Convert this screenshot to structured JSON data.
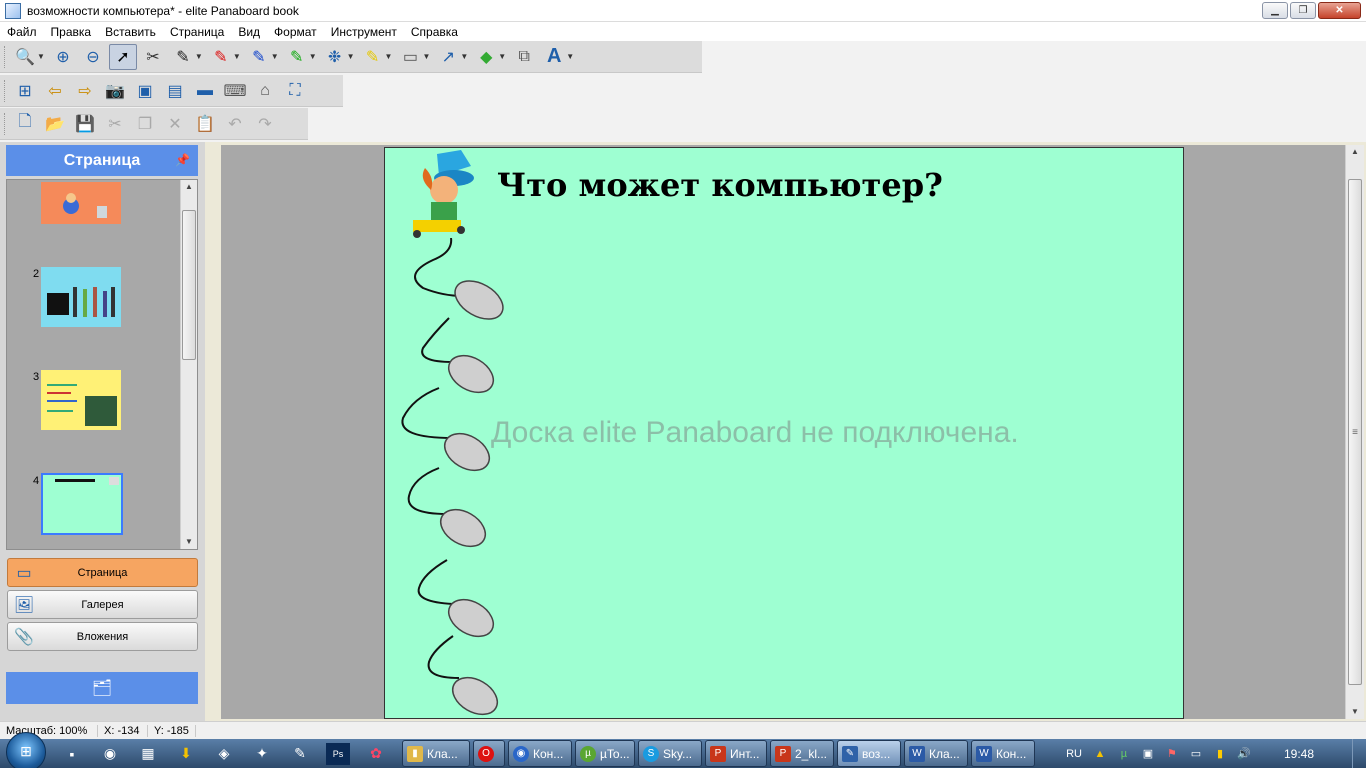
{
  "window": {
    "title": "возможности компьютера* - elite Panaboard book"
  },
  "menu": {
    "items": [
      "Файл",
      "Правка",
      "Вставить",
      "Страница",
      "Вид",
      "Формат",
      "Инструмент",
      "Справка"
    ]
  },
  "left_panel": {
    "header": "Страница",
    "thumbs": [
      {
        "num": "",
        "bg": "#f58a5a"
      },
      {
        "num": "2",
        "bg": "#7fdcf0"
      },
      {
        "num": "3",
        "bg": "#fff176"
      },
      {
        "num": "4",
        "bg": "#9effd2"
      }
    ],
    "buttons": [
      "Страница",
      "Галерея",
      "Вложения"
    ]
  },
  "slide": {
    "title": "Что может компьютер?",
    "watermark": "Доска elite Panaboard не подключена.",
    "background": "#9effd2"
  },
  "status": {
    "zoom": "Масштаб: 100%",
    "x": "X: -134",
    "y": "Y: -185"
  },
  "taskbar": {
    "tasks": [
      "Кла...",
      "",
      "Кон...",
      "µTo...",
      "Sky...",
      "Инт...",
      "2_kl...",
      "воз...",
      "Кла...",
      "Кон..."
    ],
    "lang": "RU",
    "clock": "19:48"
  },
  "colors": {
    "accent": "#5b8fe8",
    "active_nav": "#f6a561",
    "slide_bg": "#9effd2"
  }
}
